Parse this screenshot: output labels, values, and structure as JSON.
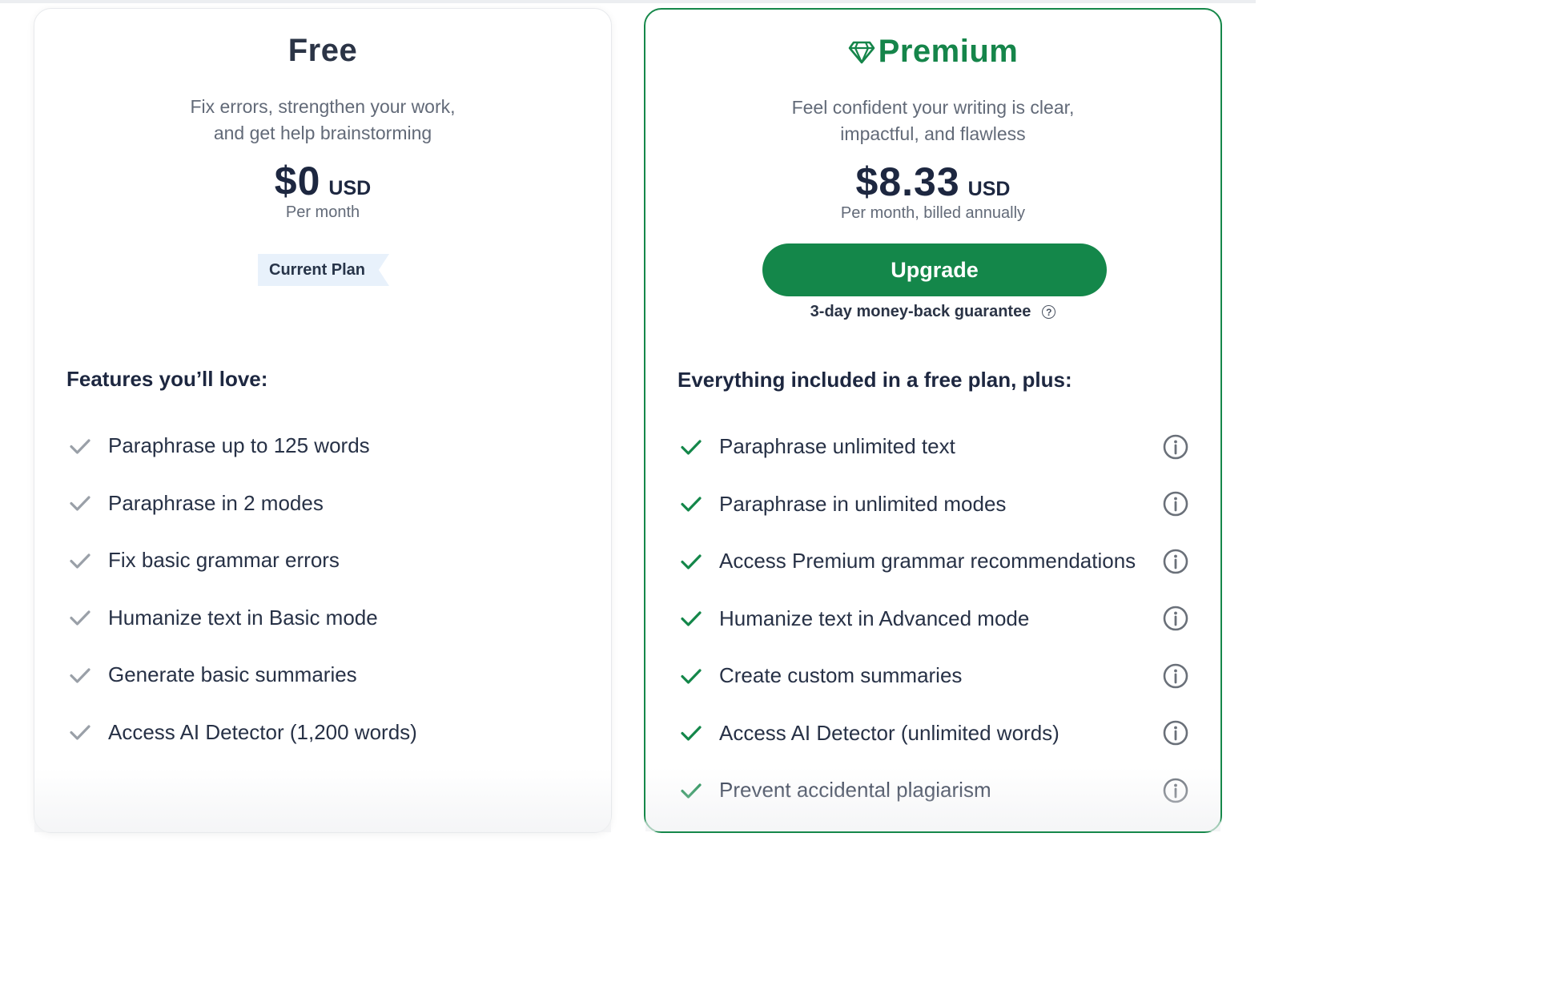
{
  "free": {
    "title": "Free",
    "desc_line1": "Fix errors, strengthen your work,",
    "desc_line2": "and get help brainstorming",
    "price": "$0",
    "currency": "USD",
    "period": "Per month",
    "current_plan_label": "Current Plan",
    "features_heading": "Features you’ll love:",
    "features": [
      "Paraphrase up to 125 words",
      "Paraphrase in 2 modes",
      "Fix basic grammar errors",
      "Humanize text in Basic mode",
      "Generate basic summaries",
      "Access AI Detector (1,200 words)"
    ]
  },
  "premium": {
    "title": "Premium",
    "desc_line1": "Feel confident your writing is clear,",
    "desc_line2": "impactful, and flawless",
    "price": "$8.33",
    "currency": "USD",
    "period": "Per month, billed annually",
    "upgrade_label": "Upgrade",
    "guarantee": "3-day money-back guarantee",
    "features_heading": "Everything included in a free plan, plus:",
    "features": [
      "Paraphrase unlimited text",
      "Paraphrase in unlimited modes",
      "Access Premium grammar recommendations",
      "Humanize text in Advanced mode",
      "Create custom summaries",
      "Access AI Detector (unlimited words)",
      "Prevent accidental plagiarism"
    ]
  },
  "icons": {
    "free_check": "check-icon-gray",
    "premium_check": "check-icon-green",
    "info": "info-icon",
    "gem": "gem-icon",
    "help": "question-icon"
  },
  "colors": {
    "brand_green": "#14874a",
    "text_dark": "#1d2740",
    "text_muted": "#626a78",
    "badge_bg": "#e8f1fb"
  }
}
